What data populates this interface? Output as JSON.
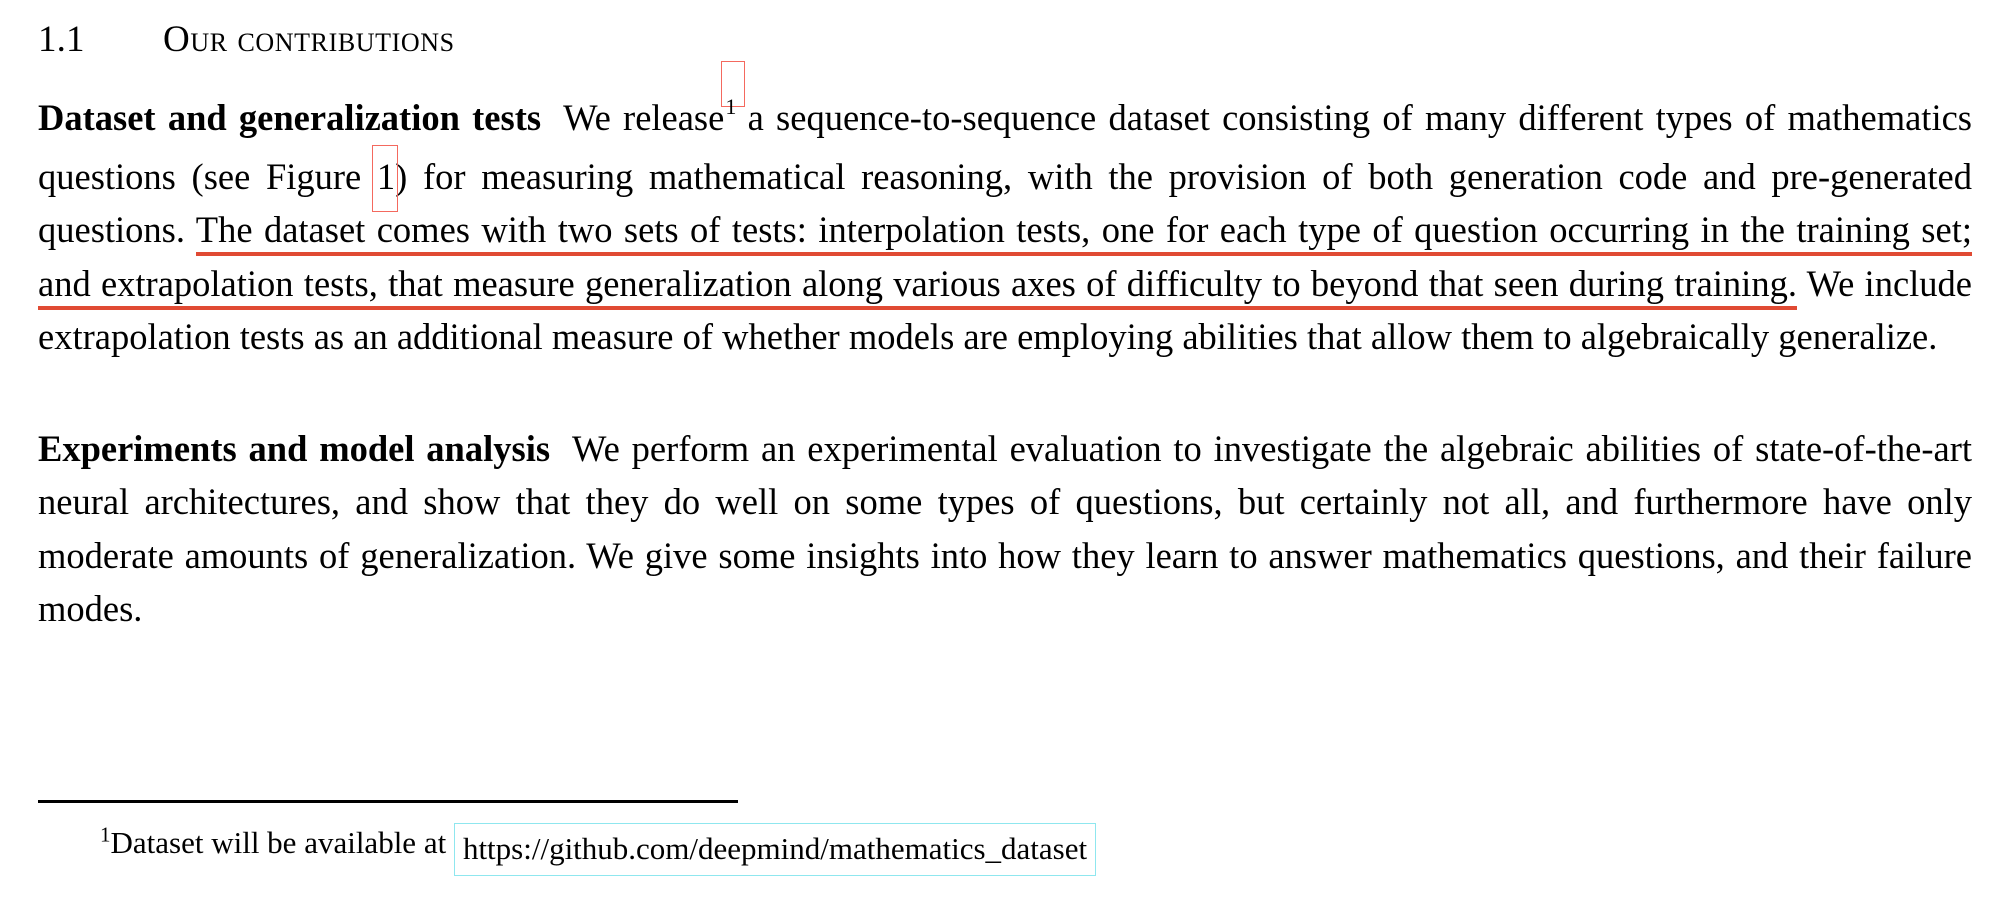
{
  "document": {
    "section": {
      "number": "1.1",
      "title": "Our contributions"
    },
    "paragraphs": [
      {
        "runin_heading": "Dataset and generalization tests",
        "text_before_footnote": "We release",
        "footnote_marker": "1",
        "text_after_footnote_1": "a sequence-to-sequence dataset consisting of many different types of mathematics questions (see Figure",
        "figure_ref": "1",
        "text_after_figure_ref": ") for measuring mathematical reasoning, with the provision of both generation code and pre-generated questions.",
        "highlighted_text": "The dataset comes with two sets of tests: interpolation tests, one for each type of question occurring in the training set; and extrapolation tests, that measure generalization along various axes of difficulty to beyond that seen during training.",
        "text_after_highlight": "We include extrapolation tests as an additional measure of whether models are employing abilities that allow them to algebraically generalize."
      },
      {
        "runin_heading": "Experiments and model analysis",
        "body": "We perform an experimental evaluation to investigate the algebraic abilities of state-of-the-art neural architectures, and show that they do well on some types of questions, but certainly not all, and furthermore have only moderate amounts of generalization. We give some insights into how they learn to answer mathematics questions, and their failure modes."
      }
    ],
    "footnote": {
      "marker": "1",
      "text": "Dataset will be available at",
      "url": "https://github.com/deepmind/mathematics_dataset"
    }
  },
  "annotations": {
    "link_box_color": "#f4695e",
    "highlight_underline_color": "#e04a33",
    "url_box_color": "#8fe7ef",
    "text_color": "#000000",
    "background_color": "#ffffff"
  }
}
